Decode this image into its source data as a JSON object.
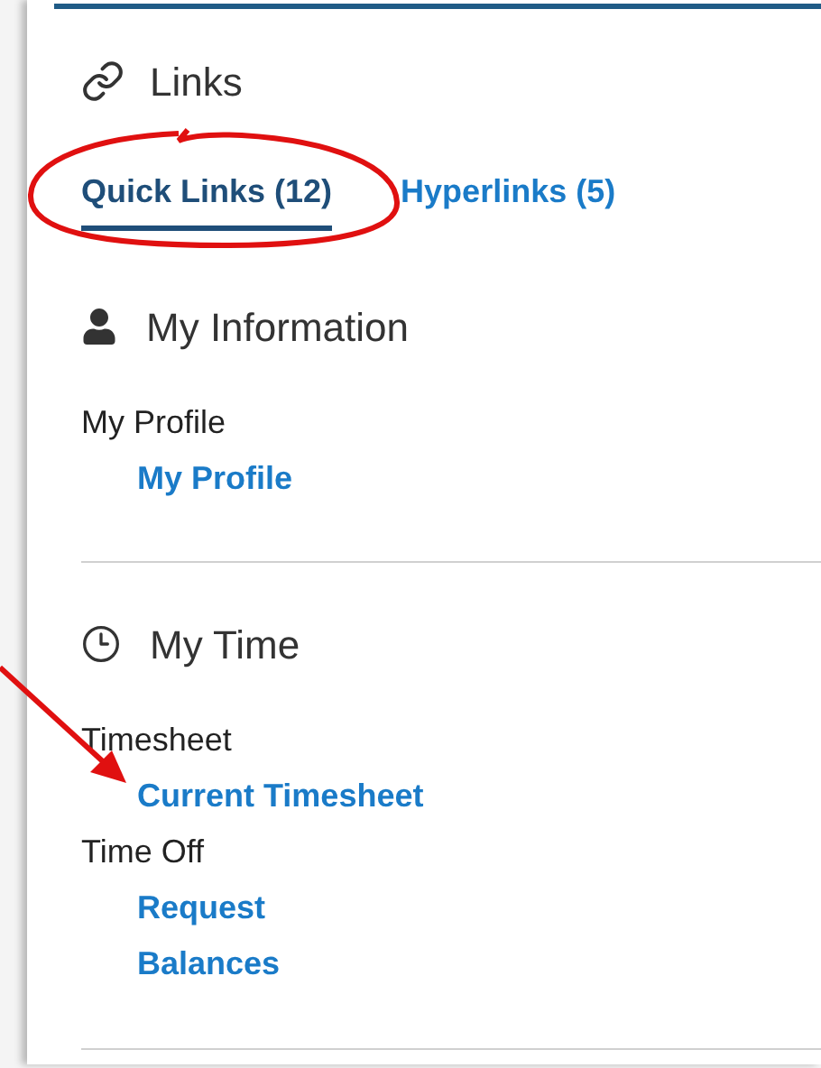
{
  "header": {
    "title": "Links"
  },
  "tabs": [
    {
      "label": "Quick Links (12)",
      "selected": true
    },
    {
      "label": "Hyperlinks (5)",
      "selected": false
    }
  ],
  "sections": [
    {
      "title": "My Information",
      "groups": [
        {
          "label": "My Profile",
          "links": [
            "My Profile"
          ]
        }
      ]
    },
    {
      "title": "My Time",
      "groups": [
        {
          "label": "Timesheet",
          "links": [
            "Current Timesheet"
          ]
        },
        {
          "label": "Time Off",
          "links": [
            "Request",
            "Balances"
          ]
        }
      ]
    }
  ]
}
